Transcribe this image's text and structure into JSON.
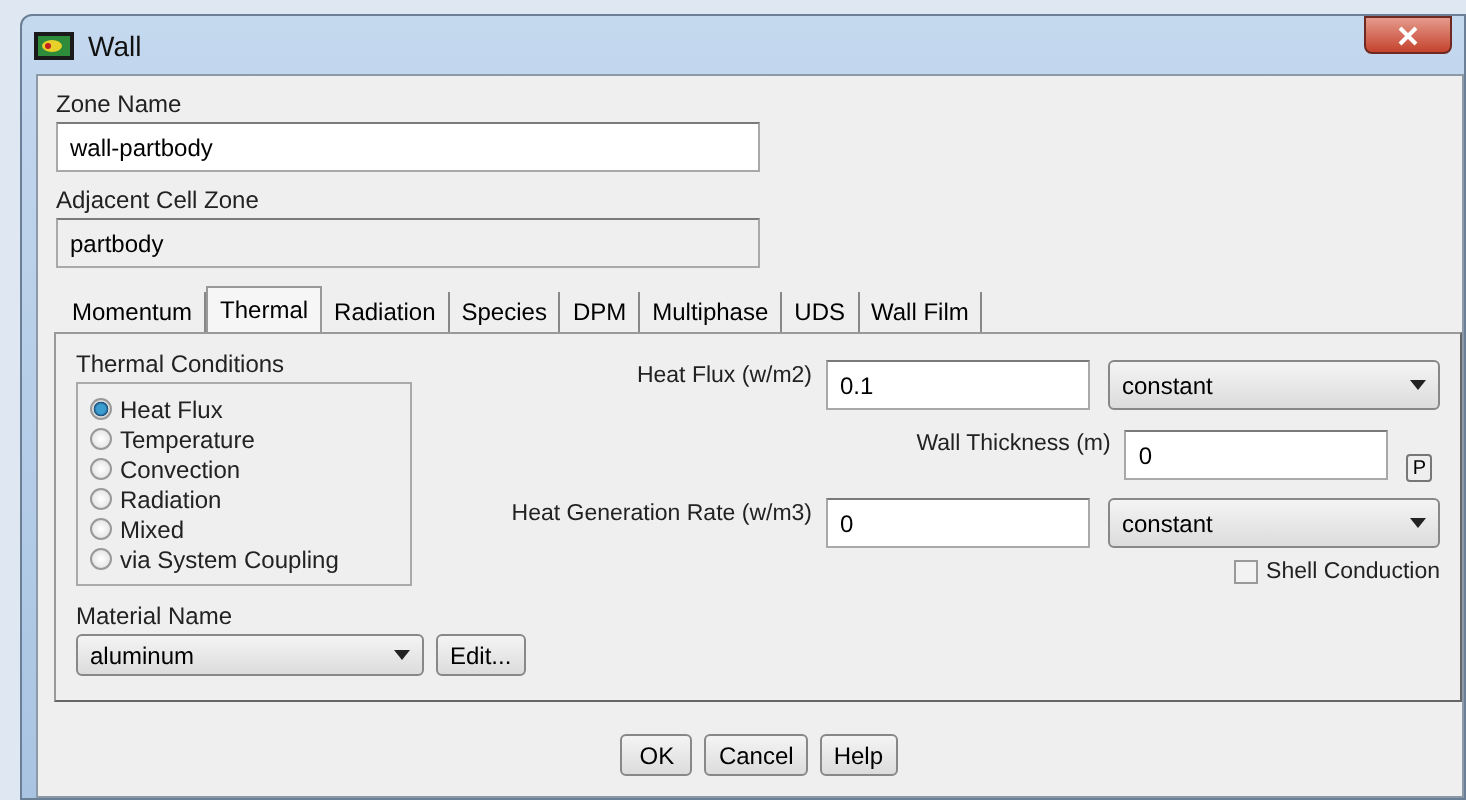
{
  "window": {
    "title": "Wall"
  },
  "zone_name": {
    "label": "Zone Name",
    "value": "wall-partbody"
  },
  "adjacent_cell_zone": {
    "label": "Adjacent Cell Zone",
    "value": "partbody"
  },
  "tabs": [
    {
      "label": "Momentum",
      "selected": false
    },
    {
      "label": "Thermal",
      "selected": true
    },
    {
      "label": "Radiation",
      "selected": false
    },
    {
      "label": "Species",
      "selected": false
    },
    {
      "label": "DPM",
      "selected": false
    },
    {
      "label": "Multiphase",
      "selected": false
    },
    {
      "label": "UDS",
      "selected": false
    },
    {
      "label": "Wall Film",
      "selected": false
    }
  ],
  "thermal_conditions": {
    "label": "Thermal Conditions",
    "options": [
      {
        "label": "Heat Flux",
        "selected": true
      },
      {
        "label": "Temperature",
        "selected": false
      },
      {
        "label": "Convection",
        "selected": false
      },
      {
        "label": "Radiation",
        "selected": false
      },
      {
        "label": "Mixed",
        "selected": false
      },
      {
        "label": "via System Coupling",
        "selected": false
      }
    ]
  },
  "material": {
    "label": "Material Name",
    "value": "aluminum",
    "edit_button": "Edit..."
  },
  "heat_flux": {
    "label": "Heat Flux (w/m2)",
    "value": "0.1",
    "method": "constant"
  },
  "wall_thickness": {
    "label": "Wall Thickness (m)",
    "value": "0",
    "parameter_button": "P"
  },
  "heat_generation": {
    "label": "Heat Generation Rate (w/m3)",
    "value": "0",
    "method": "constant"
  },
  "shell_conduction": {
    "label": "Shell Conduction",
    "checked": false
  },
  "buttons": [
    "OK",
    "Cancel",
    "Help"
  ]
}
